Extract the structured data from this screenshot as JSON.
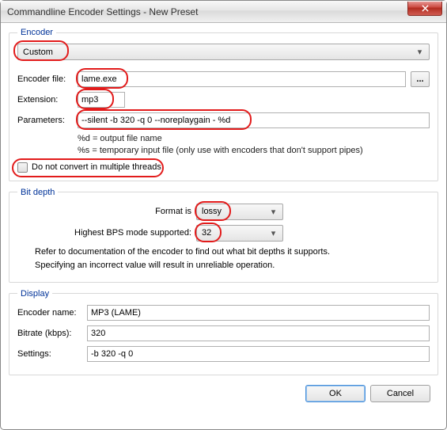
{
  "window": {
    "title": "Commandline Encoder Settings - New Preset"
  },
  "encoder_group": {
    "legend": "Encoder",
    "preset_dropdown": "Custom",
    "encoder_file_label": "Encoder file:",
    "encoder_file_value": "lame.exe",
    "browse": "...",
    "extension_label": "Extension:",
    "extension_value": "mp3",
    "parameters_label": "Parameters:",
    "parameters_value": "--silent -b 320 -q 0 --noreplaygain - %d",
    "hint_line1": "%d = output file name",
    "hint_line2": "%s = temporary input file (only use with encoders that don't support pipes)",
    "multithread_label": "Do not convert in multiple threads"
  },
  "bitdepth_group": {
    "legend": "Bit depth",
    "format_label": "Format is",
    "format_value": "lossy",
    "bps_label": "Highest BPS mode supported:",
    "bps_value": "32",
    "note_line1": "Refer to documentation of the encoder to find out what bit depths it supports.",
    "note_line2": "Specifying an incorrect value will result in unreliable operation."
  },
  "display_group": {
    "legend": "Display",
    "encoder_name_label": "Encoder name:",
    "encoder_name_value": "MP3 (LAME)",
    "bitrate_label": "Bitrate (kbps):",
    "bitrate_value": "320",
    "settings_label": "Settings:",
    "settings_value": "-b 320 -q 0"
  },
  "buttons": {
    "ok": "OK",
    "cancel": "Cancel"
  }
}
